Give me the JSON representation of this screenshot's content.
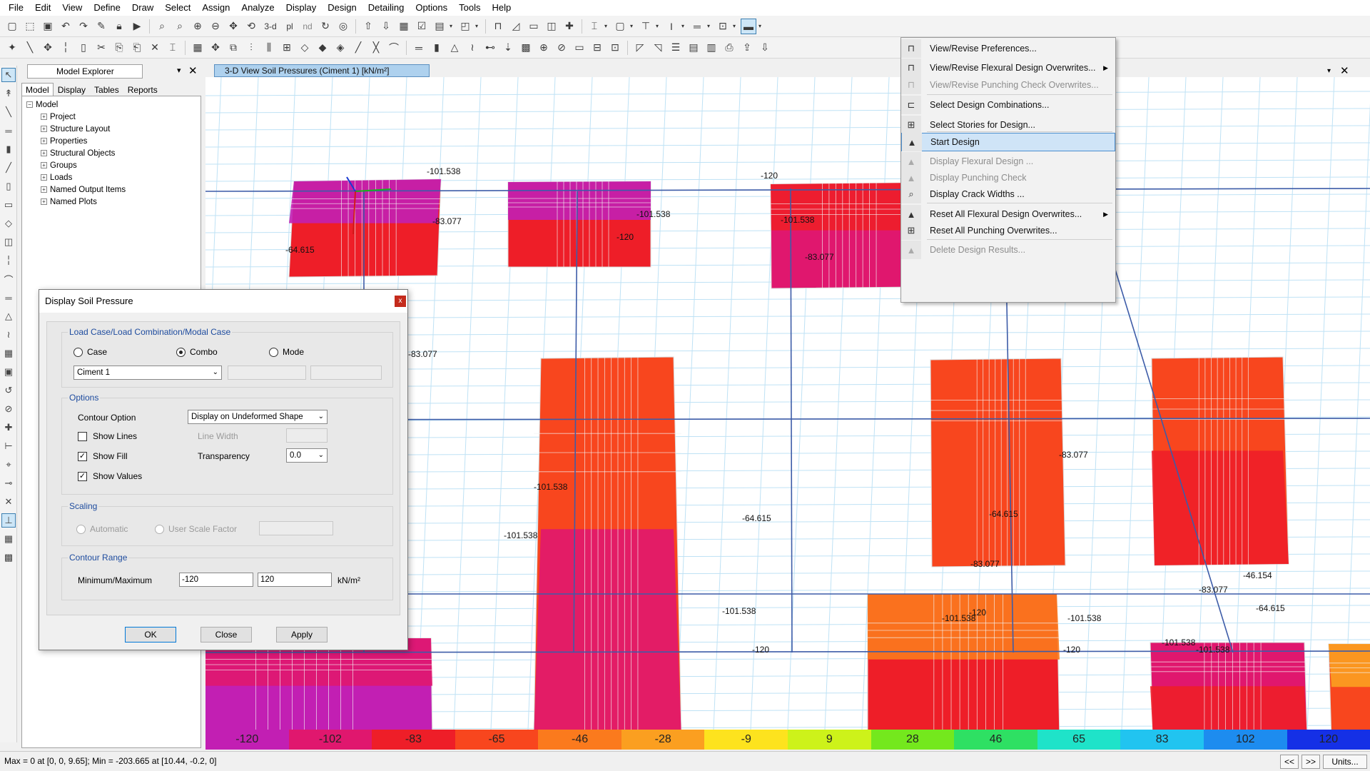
{
  "menubar": [
    "File",
    "Edit",
    "View",
    "Define",
    "Draw",
    "Select",
    "Assign",
    "Analyze",
    "Display",
    "Design",
    "Detailing",
    "Options",
    "Tools",
    "Help"
  ],
  "toolbar1": {
    "view_3d_label": "3-d",
    "plan_label": "pl",
    "elev_label": "nd"
  },
  "explorer": {
    "title": "Model Explorer",
    "tabs": [
      "Model",
      "Display",
      "Tables",
      "Reports"
    ],
    "root": "Model",
    "items": [
      "Project",
      "Structure Layout",
      "Properties",
      "Structural Objects",
      "Groups",
      "Loads",
      "Named Output Items",
      "Named Plots"
    ]
  },
  "view": {
    "tab_title": "3-D View   Soil Pressures   (Ciment 1)  [kN/m²]"
  },
  "plot_values": [
    "-101.538",
    "-83.077",
    "-64.615",
    "-120",
    "-101.538",
    "-120",
    "-101.538",
    "-83.077",
    "-83.077",
    "-83.077",
    "-101.538",
    "-101.538",
    "-64.615",
    "-64.615",
    "-83.077",
    "-101.538",
    "-101.538",
    "-120",
    "-120",
    "-101.538",
    "-120",
    "-46.154",
    "-64.615",
    "-83.077",
    "-101.538",
    "-101.538"
  ],
  "colorbar": {
    "labels": [
      "-120",
      "-102",
      "-83",
      "-65",
      "-46",
      "-28",
      "-9",
      "9",
      "28",
      "46",
      "65",
      "83",
      "102",
      "120"
    ],
    "colors": [
      "#c21fb3",
      "#e0176e",
      "#ee1e28",
      "#f8461e",
      "#fb7a1d",
      "#fb9f20",
      "#fde31e",
      "#cdf21a",
      "#74e81d",
      "#2ee063",
      "#1fe3c9",
      "#21c4f0",
      "#1d8cef",
      "#1530e6"
    ]
  },
  "statusbar": {
    "text": "Max = 0 at [0, 0, 9.65];  Min = -203.665 at [10.44, -0.2, 0]",
    "prev": "<<",
    "next": ">>",
    "units": "Units..."
  },
  "design_menu": [
    {
      "label": "View/Revise Preferences...",
      "disabled": false,
      "arrow": false
    },
    {
      "label": "View/Revise Flexural Design Overwrites...",
      "disabled": false,
      "arrow": true
    },
    {
      "label": "View/Revise Punching Check Overwrites...",
      "disabled": true,
      "arrow": false
    },
    {
      "label": "Select Design Combinations...",
      "disabled": false,
      "arrow": false
    },
    {
      "label": "Select Stories for Design...",
      "disabled": false,
      "arrow": false
    },
    {
      "label": "Start Design",
      "disabled": false,
      "arrow": false,
      "highlighted": true
    },
    {
      "label": "Display Flexural Design ...",
      "disabled": true,
      "arrow": false
    },
    {
      "label": "Display Punching Check",
      "disabled": true,
      "arrow": false
    },
    {
      "label": "Display Crack Widths ...",
      "disabled": false,
      "arrow": false
    },
    {
      "label": "Reset All Flexural Design Overwrites...",
      "disabled": false,
      "arrow": true
    },
    {
      "label": "Reset All Punching Overwrites...",
      "disabled": false,
      "arrow": false
    },
    {
      "label": "Delete Design Results...",
      "disabled": true,
      "arrow": false
    }
  ],
  "dialog": {
    "title": "Display Soil Pressure",
    "close_glyph": "x",
    "load_group": "Load Case/Load Combination/Modal Case",
    "radio_case": "Case",
    "radio_combo": "Combo",
    "radio_mode": "Mode",
    "combo_value": "Ciment 1",
    "options_group": "Options",
    "contour_option_label": "Contour Option",
    "contour_option_value": "Display on Undeformed Shape",
    "show_lines": "Show Lines",
    "show_fill": "Show Fill",
    "show_values": "Show Values",
    "line_width_label": "Line Width",
    "transparency_label": "Transparency",
    "transparency_value": "0.0",
    "scaling_group": "Scaling",
    "automatic": "Automatic",
    "user_scale": "User Scale Factor",
    "contour_group": "Contour Range",
    "minmax_label": "Minimum/Maximum",
    "min_value": "-120",
    "max_value": "120",
    "units": "kN/m²",
    "ok": "OK",
    "close": "Close",
    "apply": "Apply"
  }
}
